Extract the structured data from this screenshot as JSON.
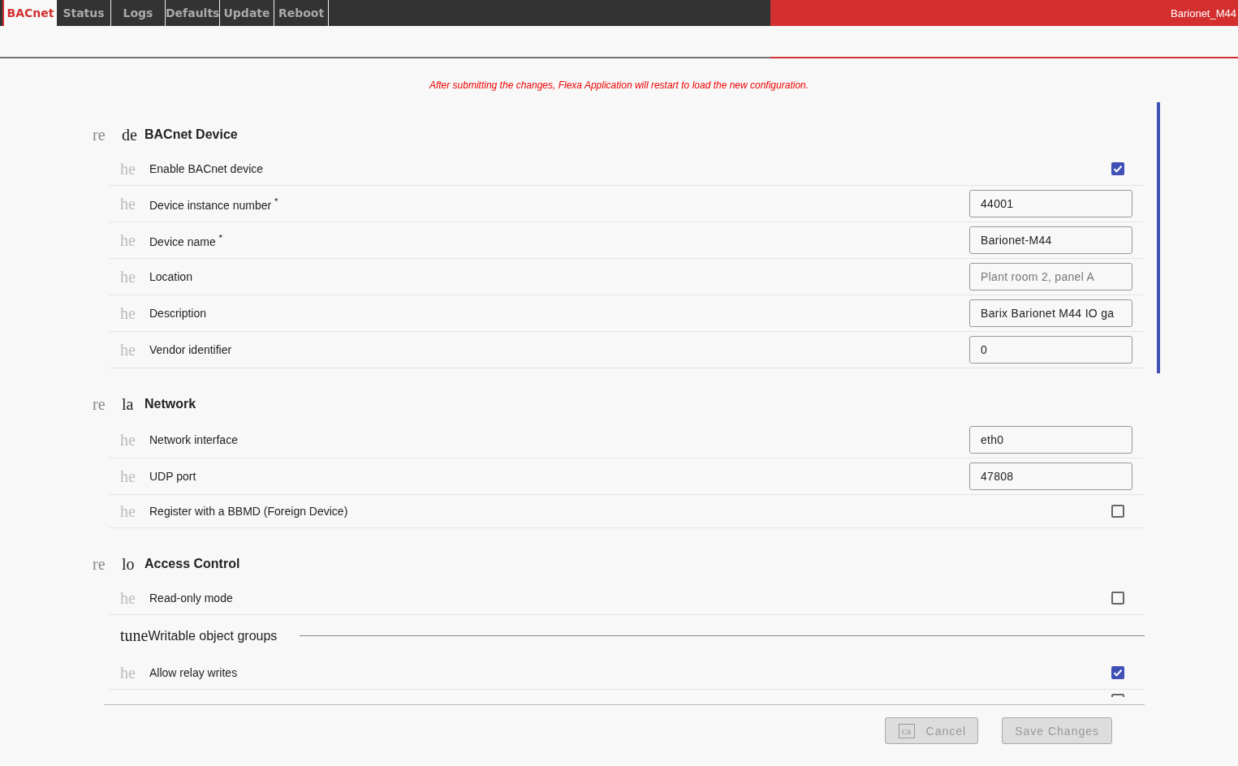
{
  "tabs": [
    {
      "label": "BACnet",
      "selected": true
    },
    {
      "label": "Status",
      "selected": false
    },
    {
      "label": "Logs",
      "selected": false
    },
    {
      "label": "Defaults",
      "selected": false
    },
    {
      "label": "Update",
      "selected": false
    },
    {
      "label": "Reboot",
      "selected": false
    }
  ],
  "device_name": "Barionet_M44",
  "notice": "After submitting the changes, Flexa Application will restart to load the new configuration.",
  "sections": [
    {
      "icon": "re",
      "title_icon": "de",
      "title": "BACnet Device",
      "items": [
        {
          "kind": "checkbox",
          "icon": "he",
          "label": "Enable BACnet device",
          "checked": true
        },
        {
          "kind": "input",
          "icon": "he",
          "label": "Device instance number $^{*}$",
          "value": "44001"
        },
        {
          "kind": "input",
          "icon": "he",
          "label": "Device name $^{*}$",
          "value": "Barionet-M44"
        },
        {
          "kind": "input",
          "icon": "he",
          "label": "Location",
          "placeholder": "Plant room 2, panel A"
        },
        {
          "kind": "input",
          "icon": "he",
          "label": "Description",
          "value": "Barix Barionet M44 IO ga"
        },
        {
          "kind": "input",
          "icon": "he",
          "label": "Vendor identifier",
          "value": "0"
        }
      ]
    },
    {
      "icon": "re",
      "title_icon": "la",
      "title": "Network",
      "items": [
        {
          "kind": "input",
          "icon": "he",
          "label": "Network interface",
          "value": "eth0"
        },
        {
          "kind": "input",
          "icon": "he",
          "label": "UDP port",
          "value": "47808"
        },
        {
          "kind": "checkbox",
          "icon": "he",
          "label": "Register with a BBMD (Foreign Device)",
          "checked": false
        }
      ]
    },
    {
      "icon": "re",
      "title_icon": "lo",
      "title": "Access Control",
      "items": [
        {
          "kind": "checkbox",
          "icon": "he",
          "label": "Read-only mode",
          "checked": false
        },
        {
          "kind": "group",
          "icon": "tune",
          "label": "Writable object groups"
        },
        {
          "kind": "checkbox",
          "icon": "he",
          "label": "Allow relay writes",
          "checked": true
        },
        {
          "kind": "cut_checkbox",
          "checked": false
        }
      ]
    }
  ],
  "buttons": [
    {
      "kind": "cancel",
      "icon": "ca",
      "label": "Cancel",
      "disabled": true
    },
    {
      "kind": "save",
      "label": "Save Changes",
      "disabled": true
    }
  ]
}
